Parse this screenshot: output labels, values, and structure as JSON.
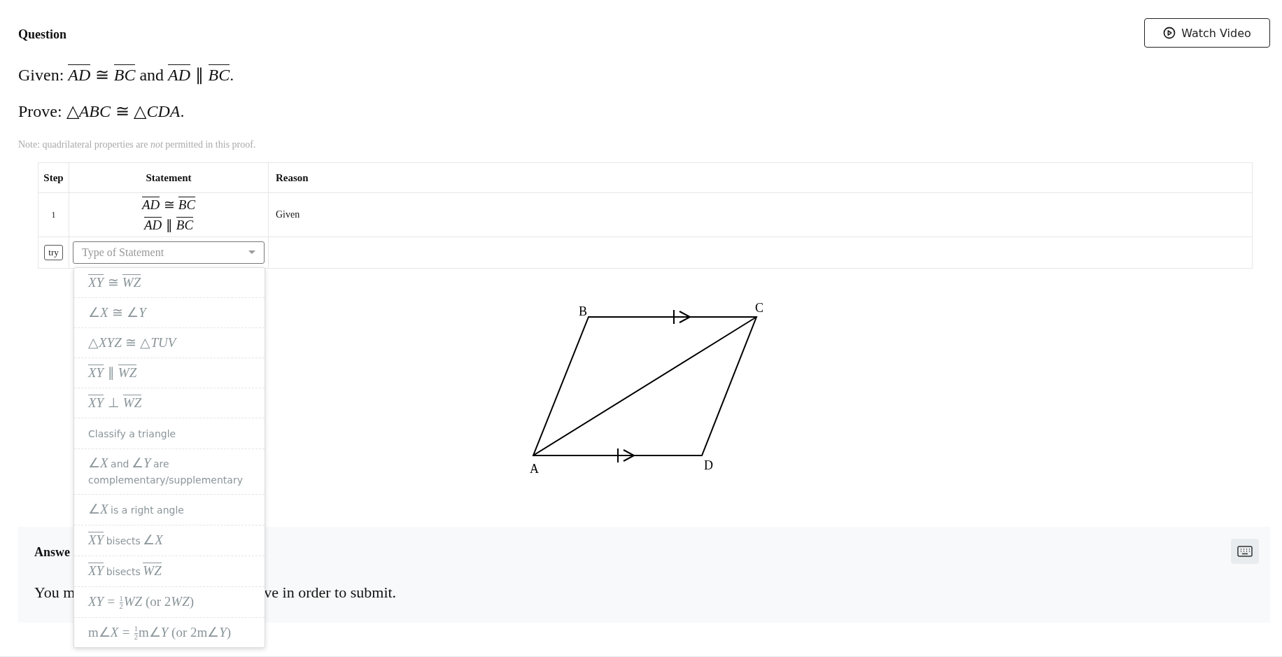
{
  "question": {
    "heading": "Question",
    "watch_button": "Watch Video",
    "given": {
      "label": "Given:",
      "parts": [
        {
          "kind": "seg",
          "text": "AD"
        },
        {
          "kind": "rel",
          "text": "≅"
        },
        {
          "kind": "seg",
          "text": "BC"
        },
        {
          "kind": "word",
          "text": "and"
        },
        {
          "kind": "seg",
          "text": "AD"
        },
        {
          "kind": "rel",
          "text": "∥"
        },
        {
          "kind": "seg",
          "text": "BC"
        },
        {
          "kind": "sym",
          "text": "."
        }
      ]
    },
    "prove": {
      "label": "Prove:",
      "parts": [
        {
          "kind": "sym",
          "text": "△"
        },
        {
          "kind": "var",
          "text": "ABC"
        },
        {
          "kind": "rel",
          "text": "≅"
        },
        {
          "kind": "sym",
          "text": "△"
        },
        {
          "kind": "var",
          "text": "CDA"
        },
        {
          "kind": "sym",
          "text": "."
        }
      ]
    },
    "note": "Note: quadrilateral properties are *not* permitted in this proof."
  },
  "proof_table": {
    "columns": [
      "Step",
      "Statement",
      "Reason"
    ],
    "rows": [
      {
        "step": "1",
        "statements": [
          [
            {
              "kind": "seg",
              "text": "AD"
            },
            {
              "kind": "rel",
              "text": "≅"
            },
            {
              "kind": "seg",
              "text": "BC"
            }
          ],
          [
            {
              "kind": "seg",
              "text": "AD"
            },
            {
              "kind": "rel",
              "text": "∥"
            },
            {
              "kind": "seg",
              "text": "BC"
            }
          ]
        ],
        "reason": "Given"
      }
    ],
    "new_row": {
      "try_button": "try",
      "select": {
        "placeholder": "Type of Statement",
        "expanded": true
      }
    }
  },
  "statement_menu": [
    {
      "parts": [
        {
          "kind": "seg",
          "text": "XY"
        },
        {
          "kind": "rel",
          "text": "≅"
        },
        {
          "kind": "seg",
          "text": "WZ"
        }
      ]
    },
    {
      "parts": [
        {
          "kind": "sym",
          "text": "∠"
        },
        {
          "kind": "var",
          "text": "X"
        },
        {
          "kind": "rel",
          "text": "≅"
        },
        {
          "kind": "sym",
          "text": "∠"
        },
        {
          "kind": "var",
          "text": "Y"
        }
      ]
    },
    {
      "parts": [
        {
          "kind": "sym",
          "text": "△"
        },
        {
          "kind": "var",
          "text": "XYZ"
        },
        {
          "kind": "rel",
          "text": "≅"
        },
        {
          "kind": "sym",
          "text": "△"
        },
        {
          "kind": "var",
          "text": "TUV"
        }
      ]
    },
    {
      "parts": [
        {
          "kind": "seg",
          "text": "XY"
        },
        {
          "kind": "rel",
          "text": "∥"
        },
        {
          "kind": "seg",
          "text": "WZ"
        }
      ]
    },
    {
      "parts": [
        {
          "kind": "seg",
          "text": "XY"
        },
        {
          "kind": "rel",
          "text": "⊥"
        },
        {
          "kind": "seg",
          "text": "WZ"
        }
      ]
    },
    {
      "parts": [
        {
          "kind": "word",
          "text": "Classify a triangle"
        }
      ]
    },
    {
      "parts": [
        {
          "kind": "sym",
          "text": "∠"
        },
        {
          "kind": "var",
          "text": "X"
        },
        {
          "kind": "word",
          "text": "and"
        },
        {
          "kind": "sym",
          "text": "∠"
        },
        {
          "kind": "var",
          "text": "Y"
        },
        {
          "kind": "word",
          "text": "are complementary/supplementary"
        }
      ]
    },
    {
      "parts": [
        {
          "kind": "sym",
          "text": "∠"
        },
        {
          "kind": "var",
          "text": "X"
        },
        {
          "kind": "word",
          "text": "is a right angle"
        }
      ]
    },
    {
      "parts": [
        {
          "kind": "seg",
          "text": "XY"
        },
        {
          "kind": "word",
          "text": "bisects"
        },
        {
          "kind": "sym",
          "text": "∠"
        },
        {
          "kind": "var",
          "text": "X"
        }
      ]
    },
    {
      "parts": [
        {
          "kind": "seg",
          "text": "XY"
        },
        {
          "kind": "word",
          "text": "bisects"
        },
        {
          "kind": "seg",
          "text": "WZ"
        }
      ]
    },
    {
      "parts": [
        {
          "kind": "var",
          "text": "XY"
        },
        {
          "kind": "rel",
          "text": "="
        },
        {
          "kind": "frac",
          "num": "1",
          "den": "2"
        },
        {
          "kind": "var",
          "text": "WZ"
        },
        {
          "kind": "sym",
          "text": " (or 2"
        },
        {
          "kind": "var",
          "text": "WZ"
        },
        {
          "kind": "sym",
          "text": ")"
        }
      ]
    },
    {
      "parts": [
        {
          "kind": "sym",
          "text": "m∠"
        },
        {
          "kind": "var",
          "text": "X"
        },
        {
          "kind": "rel",
          "text": "="
        },
        {
          "kind": "frac",
          "num": "1",
          "den": "2"
        },
        {
          "kind": "sym",
          "text": "m∠"
        },
        {
          "kind": "var",
          "text": "Y"
        },
        {
          "kind": "sym",
          "text": " (or 2m∠"
        },
        {
          "kind": "var",
          "text": "Y"
        },
        {
          "kind": "sym",
          "text": ")"
        }
      ]
    }
  ],
  "diagram": {
    "vertices": [
      {
        "label": "A"
      },
      {
        "label": "B"
      },
      {
        "label": "C"
      },
      {
        "label": "D"
      }
    ]
  },
  "answer": {
    "heading": "Answe",
    "message_start": "You m",
    "message_end": "ve in order to submit."
  }
}
